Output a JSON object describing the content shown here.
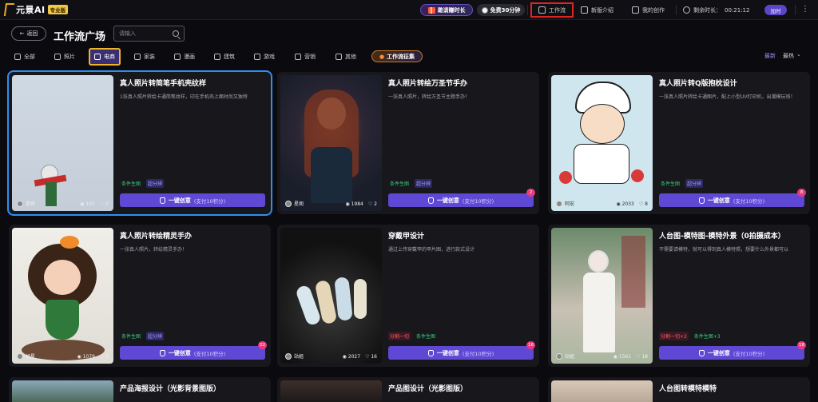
{
  "topbar": {
    "logo_text": "元景AI",
    "pro_badge": "专业版",
    "invite_label": "邀请赚时长",
    "free_label": "免费30分钟",
    "workflow_label": "工作流",
    "new_label": "新版介绍",
    "mine_label": "我的创作",
    "remain_label": "剩余时长：",
    "remain_value": "00:21:12",
    "add_label": "加时"
  },
  "header": {
    "back_label": "返回",
    "title": "工作流广场",
    "search_placeholder": "请输入"
  },
  "categories": [
    {
      "label": "全部",
      "icon": "grid-icon"
    },
    {
      "label": "照片",
      "icon": "camera-icon"
    },
    {
      "label": "电商",
      "icon": "bag-icon"
    },
    {
      "label": "家装",
      "icon": "sofa-icon"
    },
    {
      "label": "漫画",
      "icon": "image-icon"
    },
    {
      "label": "建筑",
      "icon": "building-icon"
    },
    {
      "label": "游戏",
      "icon": "gamepad-icon"
    },
    {
      "label": "营销",
      "icon": "megaphone-icon"
    },
    {
      "label": "其他",
      "icon": "gear-icon"
    }
  ],
  "featured_pill": "工作流征集",
  "sort": {
    "latest": "最新",
    "hot": "最热"
  },
  "cards": [
    {
      "title": "真人照片转简笔手机壳纹样",
      "desc": "1张真人照片转绘卡通简笔纹样，印在手机壳上面时尚又独特",
      "author": "盘婷",
      "views": "197",
      "likes": "0",
      "tags": [
        {
          "t": "条件生图",
          "c": "green"
        },
        {
          "t": "超分辨",
          "c": "blue"
        }
      ],
      "cta": "一键创意",
      "cta_sub": "(支付10积分)",
      "badge": ""
    },
    {
      "title": "真人照片转绘万圣节手办",
      "desc": "一张真人照片，转绘万圣节主题手办！",
      "author": "星阁",
      "views": "1984",
      "likes": "2",
      "tags": [
        {
          "t": "条件生图",
          "c": "green"
        },
        {
          "t": "超分辨",
          "c": "blue"
        }
      ],
      "cta": "一键创意",
      "cta_sub": "(支付10积分)",
      "badge": "2"
    },
    {
      "title": "真人照片转Q版抱枕设计",
      "desc": "一张真人照片转绘卡通图片，配上小型UV打印机，出潮模玩钱！",
      "author": "阿宏",
      "views": "2033",
      "likes": "8",
      "tags": [
        {
          "t": "条件生图",
          "c": "green"
        },
        {
          "t": "超分辨",
          "c": "blue"
        }
      ],
      "cta": "一键创意",
      "cta_sub": "(支付10积分)",
      "badge": "8"
    },
    {
      "title": "真人照片转绘精灵手办",
      "desc": "一张真人照片，转绘精灵手办！",
      "author": "胡星",
      "views": "1079",
      "likes": "2",
      "tags": [
        {
          "t": "条件生图",
          "c": "green"
        },
        {
          "t": "超分辨",
          "c": "blue"
        }
      ],
      "cta": "一键创意",
      "cta_sub": "(支付10积分)",
      "badge": "22"
    },
    {
      "title": "穿戴甲设计",
      "desc": "通过上传穿戴甲的甲片图，进行款式设计",
      "author": "站姐",
      "views": "2027",
      "likes": "16",
      "tags": [
        {
          "t": "分割一切",
          "c": "red"
        },
        {
          "t": "条件生图",
          "c": "green"
        }
      ],
      "cta": "一键创意",
      "cta_sub": "(支付10积分)",
      "badge": "16"
    },
    {
      "title": "人台图-模特图-模特外景（0拍摄成本）",
      "desc": "不需要请模特，就可以得到真人模特照，想要什么外景都可以",
      "author": "站姐",
      "views": "1561",
      "likes": "18",
      "tags": [
        {
          "t": "分割一切+2",
          "c": "red"
        },
        {
          "t": "条件生图+3",
          "c": "green"
        }
      ],
      "cta": "一键创意",
      "cta_sub": "(支付10积分)",
      "badge": "18"
    },
    {
      "title": "产品海报设计（光影背景图版）",
      "desc": "",
      "author": "",
      "views": "",
      "likes": "",
      "tags": [],
      "cta": "",
      "cta_sub": "",
      "badge": ""
    },
    {
      "title": "产品图设计（光影图版）",
      "desc": "",
      "author": "",
      "views": "",
      "likes": "",
      "tags": [],
      "cta": "",
      "cta_sub": "",
      "badge": ""
    },
    {
      "title": "人台图转模特模特",
      "desc": "",
      "author": "",
      "views": "",
      "likes": "",
      "tags": [],
      "cta": "",
      "cta_sub": "",
      "badge": ""
    }
  ]
}
